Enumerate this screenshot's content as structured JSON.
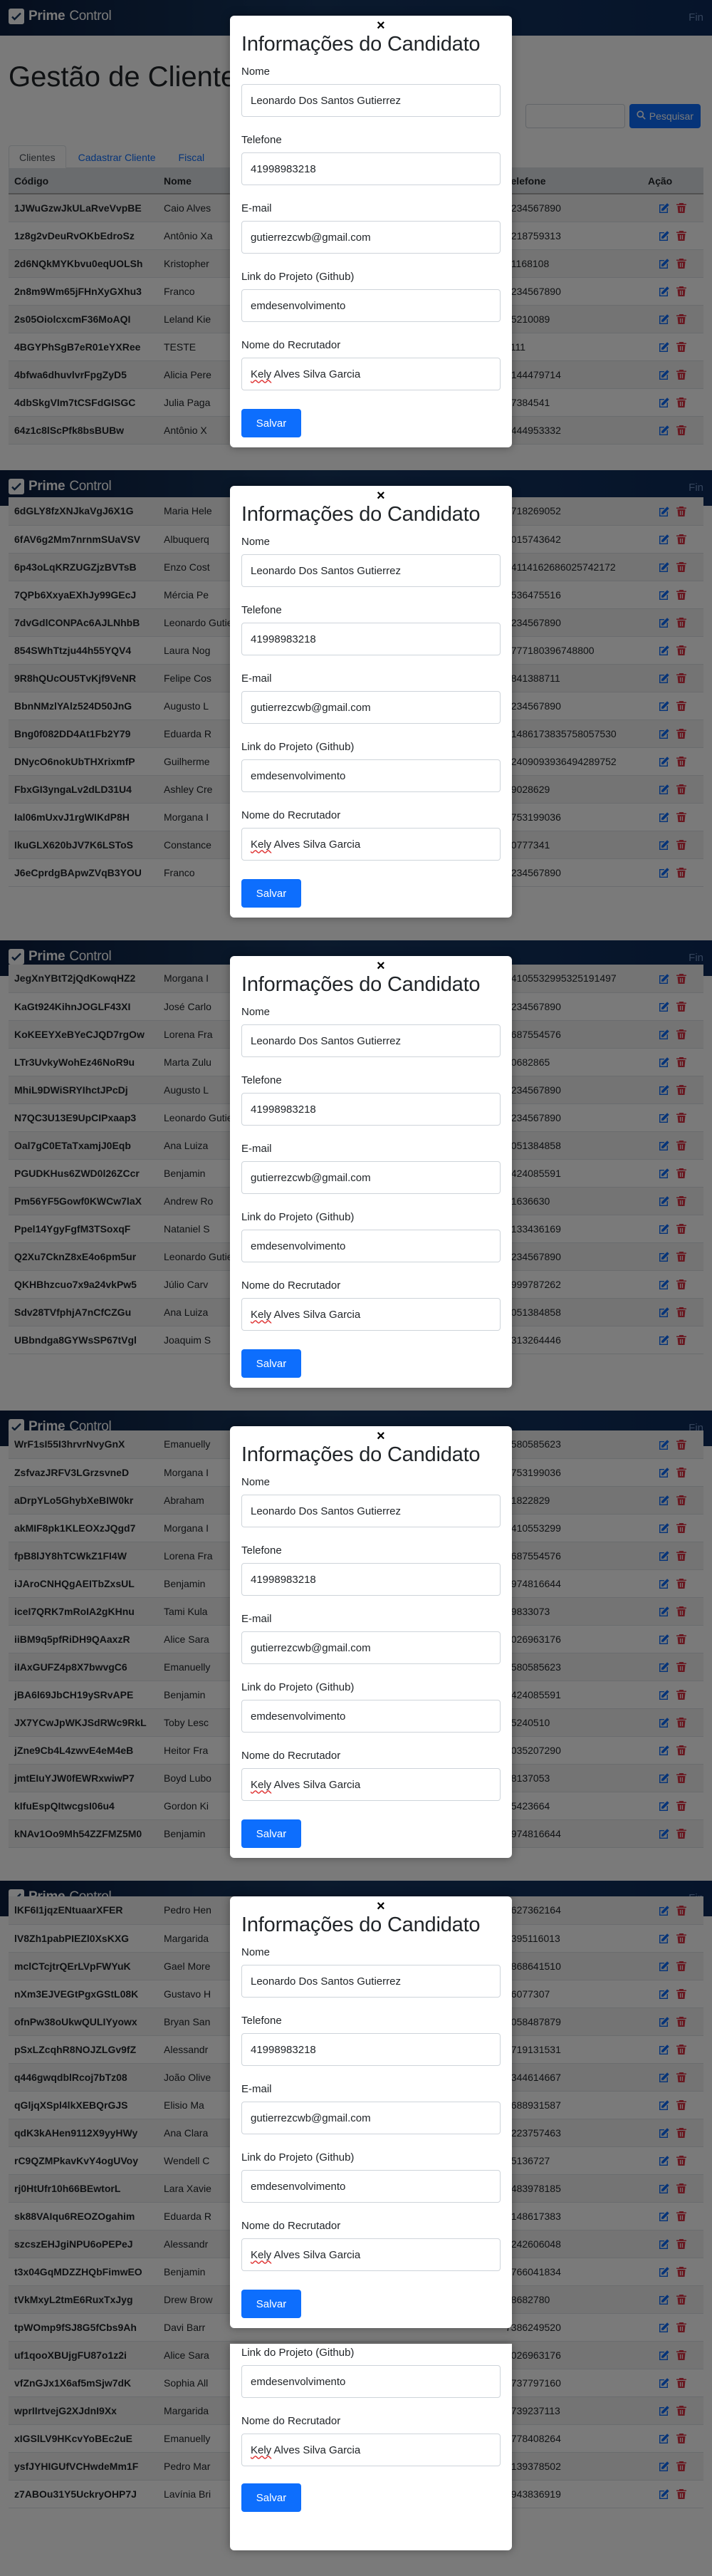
{
  "nav": {
    "brand_prefix": "Prime",
    "brand_suffix": "Control",
    "right_link": "Fin"
  },
  "page": {
    "title": "Gestão de Clientes"
  },
  "search": {
    "button_label": "Pesquisar"
  },
  "tabs": [
    {
      "label": "Clientes"
    },
    {
      "label": "Cadastrar Cliente"
    },
    {
      "label": "Fiscal"
    }
  ],
  "table_headers": [
    "Código",
    "Nome",
    "",
    "Telefone",
    "Ação"
  ],
  "modal": {
    "title": "Informações do Candidato",
    "close": "×",
    "fields": [
      {
        "label": "Nome",
        "value": "Leonardo Dos Santos Gutierrez"
      },
      {
        "label": "Telefone",
        "value": "41998983218"
      },
      {
        "label": "E-mail",
        "value": "gutierrezcwb@gmail.com"
      },
      {
        "label": "Link do Projeto (Github)",
        "value": "emdesenvolvimento"
      },
      {
        "label": "Nome do Recrutador",
        "value_first": "Kely",
        "value_rest": " Alves Silva Garcia"
      }
    ],
    "save_label": "Salvar"
  },
  "segments": [
    {
      "rows": [
        {
          "code": "1JWuGzwJkULaRveVvpBE",
          "name": "Caio Alves",
          "phone": "1234567890"
        },
        {
          "code": "1z8g2vDeuRvOKbEdroSz",
          "name": "Antônio Xa",
          "phone": "6218759313"
        },
        {
          "code": "2d6NQkMYKbvu0eqUOLSh",
          "name": "Kristopher",
          "phone": "21168108"
        },
        {
          "code": "2n8m9Wm65jFHnXyGXhu3",
          "name": "Franco",
          "phone": "1234567890"
        },
        {
          "code": "2s05OiolcxcmF36MoAQI",
          "name": "Leland Kie",
          "phone": "55210089"
        },
        {
          "code": "4BGYPhSgB7eR01eYXRee",
          "name": "TESTE",
          "phone": "1111"
        },
        {
          "code": "4bfwa6dhuvlvrFpgZyD5",
          "name": "Alicia Pere",
          "phone": "4144479714"
        },
        {
          "code": "4dbSkgVIm7tCSFdGISGC",
          "name": "Julia Paga",
          "phone": "67384541"
        },
        {
          "code": "64z1c8lScPfk8bsBUBw",
          "name": "Antônio X",
          "phone": "6444953332"
        }
      ]
    },
    {
      "rows": [
        {
          "code": "6dGLY8fzXNJkaVgJ6X1G",
          "name": "Maria Hele",
          "phone": "7718269052"
        },
        {
          "code": "6fAV6g2Mm7nrnmSUaVSV",
          "name": "Albuquerq",
          "phone": "4015743642"
        },
        {
          "code": "6p43oLqKRZUGZjzBVTsB",
          "name": "Enzo Cost",
          "phone": "74114162686025742172"
        },
        {
          "code": "7QPb6XxyaEXhJy99GEcJ",
          "name": "Mércia Pe",
          "phone": "9536475516"
        },
        {
          "code": "7dvGdlCONPAc6AJLNhbB",
          "name": "Leonardo Gutierrez",
          "phone": "1234567890"
        },
        {
          "code": "854SWhTtzju44h55YQV4",
          "name": "Laura Nog",
          "phone": "1777180396748800"
        },
        {
          "code": "9R8hQUcOU5TvKjf9VeNR",
          "name": "Felipe Cos",
          "phone": "3841388711"
        },
        {
          "code": "BbnNMzlYAlz524D50JnG",
          "name": "Augusto L",
          "phone": "1234567890"
        },
        {
          "code": "Bng0f082DD4At1Fb2Y79",
          "name": "Eduarda R",
          "phone": "71486173835758057530"
        },
        {
          "code": "DNycO6nokUbTHXrixmfP",
          "name": "Guilherme",
          "phone": "22409093936494289752"
        },
        {
          "code": "FbxGI3yngaLv2dLD31U4",
          "name": "Ashley Cre",
          "phone": "89028629"
        },
        {
          "code": "Ial06mUxvJ1rgWIKdP8H",
          "name": "Morgana I",
          "phone": "7753199036"
        },
        {
          "code": "IkuGLX620bJV7K6LSToS",
          "name": "Constance",
          "phone": "70777341"
        },
        {
          "code": "J6eCprdgBApwZVqB3YOU",
          "name": "Franco",
          "phone": "1234567890"
        }
      ]
    },
    {
      "rows": [
        {
          "code": "JegXnYBtT2jQdKowqHZ2",
          "name": "Morgana I",
          "phone": "94105532995325191497"
        },
        {
          "code": "KaGt924KihnJOGLF43XI",
          "name": "José Carlo",
          "phone": "1234567890"
        },
        {
          "code": "KoKEEYXeBYeCJQD7rgOw",
          "name": "Lorena Fra",
          "phone": "5687554576"
        },
        {
          "code": "LTr3UvkyWohEz46NoR9u",
          "name": "Marta Zulu",
          "phone": "50682865"
        },
        {
          "code": "MhiL9DWiSRYIhctJPcDj",
          "name": "Augusto L",
          "phone": "1234567890"
        },
        {
          "code": "N7QC3U13E9UpCIPxaap3",
          "name": "Leonardo Gutierrez",
          "phone": "1234567890"
        },
        {
          "code": "Oal7gC0ETaTxamjJ0Eqb",
          "name": "Ana Luiza",
          "phone": "9051384858"
        },
        {
          "code": "PGUDKHus6ZWD0l26ZCcr",
          "name": "Benjamin",
          "phone": "8424085591"
        },
        {
          "code": "Pm56YF5Gowf0KWCw7laX",
          "name": "Andrew Ro",
          "phone": "61636630"
        },
        {
          "code": "Ppel14YgyFgfM3TSoxqF",
          "name": "Nataniel S",
          "phone": "2133436169"
        },
        {
          "code": "Q2Xu7CknZ8xE4o6pm5ur",
          "name": "Leonardo Gutierrez",
          "phone": "1234567890"
        },
        {
          "code": "QKHBhzcuo7x9a24vkPw5",
          "name": "Júlio Carv",
          "phone": "4999787262"
        },
        {
          "code": "Sdv28TVfphjA7nCfCZGu",
          "name": "Ana Luiza",
          "phone": "9051384858"
        },
        {
          "code": "UBbndga8GYWsSP67tVgl",
          "name": "Joaquim S",
          "phone": "3313264446"
        }
      ]
    },
    {
      "rows": [
        {
          "code": "WrF1sI55I3hrvrNvyGnX",
          "name": "Emanuelly",
          "phone": "6580585623"
        },
        {
          "code": "ZsfvazJRFV3LGrzsvneD",
          "name": "Morgana I",
          "phone": "7753199036"
        },
        {
          "code": "aDrpYLo5GhybXeBIW0kr",
          "name": "Abraham",
          "phone": "21822829"
        },
        {
          "code": "akMIF8pk1KLEOXzJQgd7",
          "name": "Morgana I",
          "phone": "9410553299"
        },
        {
          "code": "fpB8lJY8hTCWkZ1FI4W",
          "name": "Lorena Fra",
          "phone": "5687554576"
        },
        {
          "code": "iJAroCNHQgAEITbZxsUL",
          "name": "Benjamin",
          "phone": "6974816644"
        },
        {
          "code": "iceI7QRK7mRoIA2gKHnu",
          "name": "Tami Kula",
          "phone": "79833073"
        },
        {
          "code": "iiBM9q5pfRiDH9QAaxzR",
          "name": "Alice Sara",
          "phone": "8026963176"
        },
        {
          "code": "iIAxGUFZ4p8X7bwvgC6",
          "name": "Emanuelly",
          "phone": "6580585623"
        },
        {
          "code": "jBA6l69JbCH19ySRvAPE",
          "name": "Benjamin",
          "phone": "8424085591"
        },
        {
          "code": "JX7YCwJpWKJSdRWc9RkL",
          "name": "Toby Lesc",
          "phone": "45240510"
        },
        {
          "code": "jZne9Cb4L4zwvE4eM4eB",
          "name": "Heitor Fra",
          "phone": "4035207290"
        },
        {
          "code": "jmtEIuYJW0fEWRxwiwP7",
          "name": "Boyd Lubo",
          "phone": "68137053"
        },
        {
          "code": "kIfuEspQItwcgsI06u4",
          "name": "Gordon Ki",
          "phone": "65423664"
        },
        {
          "code": "kNAv1Oo9Mh54ZZFMZ5M0",
          "name": "Benjamin",
          "phone": "6974816644"
        }
      ]
    },
    {
      "rows": [
        {
          "code": "lKF6I1jqzENtuaarXFER",
          "name": "Pedro Hen",
          "phone": "7627362164"
        },
        {
          "code": "lV8Zh1pabPIEZl0XsKXG",
          "name": "Margarida",
          "phone": "3395116013"
        },
        {
          "code": "mclCTcjtrQErLVpFWYuK",
          "name": "Gael More",
          "phone": "6868641510"
        },
        {
          "code": "nXm3EJVEGtPgxGStL08K",
          "name": "Gustavo H",
          "phone": "76077307"
        },
        {
          "code": "ofnPw38oUkwQULIYyowx",
          "name": "Bryan San",
          "phone": "5058487879"
        },
        {
          "code": "pSxLZcqhR8NOJZLGv9fZ",
          "name": "Alessandr",
          "phone": "7719131531"
        },
        {
          "code": "q446gwqdblRcoj7bTz08",
          "name": "João Olive",
          "phone": "3344614667"
        },
        {
          "code": "qGljqXSpl4lkXEBQrGJS",
          "name": "Elisio Ma",
          "phone": "2688931587"
        },
        {
          "code": "qdK3kAHen9112X9yyHWy",
          "name": "Ana Clara",
          "phone": "6223757463"
        },
        {
          "code": "rC9QZMPkavKvY4ogUVoy",
          "name": "Wendell C",
          "phone": "25136727"
        },
        {
          "code": "rj0HtUfr10h66BEwtorL",
          "name": "Lara Xavie",
          "phone": "3483978185"
        },
        {
          "code": "sk88VAIqu6REOZOgahim",
          "name": "Eduarda R",
          "phone": "7148617383"
        },
        {
          "code": "szcszEHJgiNPU6oPEPeJ",
          "name": "Alessandr",
          "phone": "7242606048"
        },
        {
          "code": "t3x04GqMDZZHQbFimwEO",
          "name": "Benjamin",
          "phone": "2766041834"
        },
        {
          "code": "tVkMxyL2tmE6RuxTxJyg",
          "name": "Drew Brow",
          "phone": "98682780"
        },
        {
          "code": "tpWOmp9fSJ8G5fCbs9Ah",
          "name": "Davi Barr",
          "phone": "7386249520"
        },
        {
          "code": "uf1qooXBUjgFU87o1z2i",
          "name": "Alice Sara",
          "phone": "8026963176"
        },
        {
          "code": "vfZnGJx1X6af5mSjw7dK",
          "name": "Sophia All",
          "phone": "7737797160"
        },
        {
          "code": "wprIIrtvejG2XJdnI9Xx",
          "name": "Margarida",
          "phone": "1739237113"
        },
        {
          "code": "xIGSlLV9HKcvYoBEc2uE",
          "name": "Emanuelly",
          "phone": "2778408264"
        },
        {
          "code": "ysfJYHIGUfVCHwdeMm1F",
          "name": "Pedro Mar",
          "phone": "7139378502"
        },
        {
          "code": "z7ABOu31Y5UckryOHP7J",
          "name": "Lavínia Bri",
          "phone": "4943836919"
        }
      ]
    }
  ]
}
